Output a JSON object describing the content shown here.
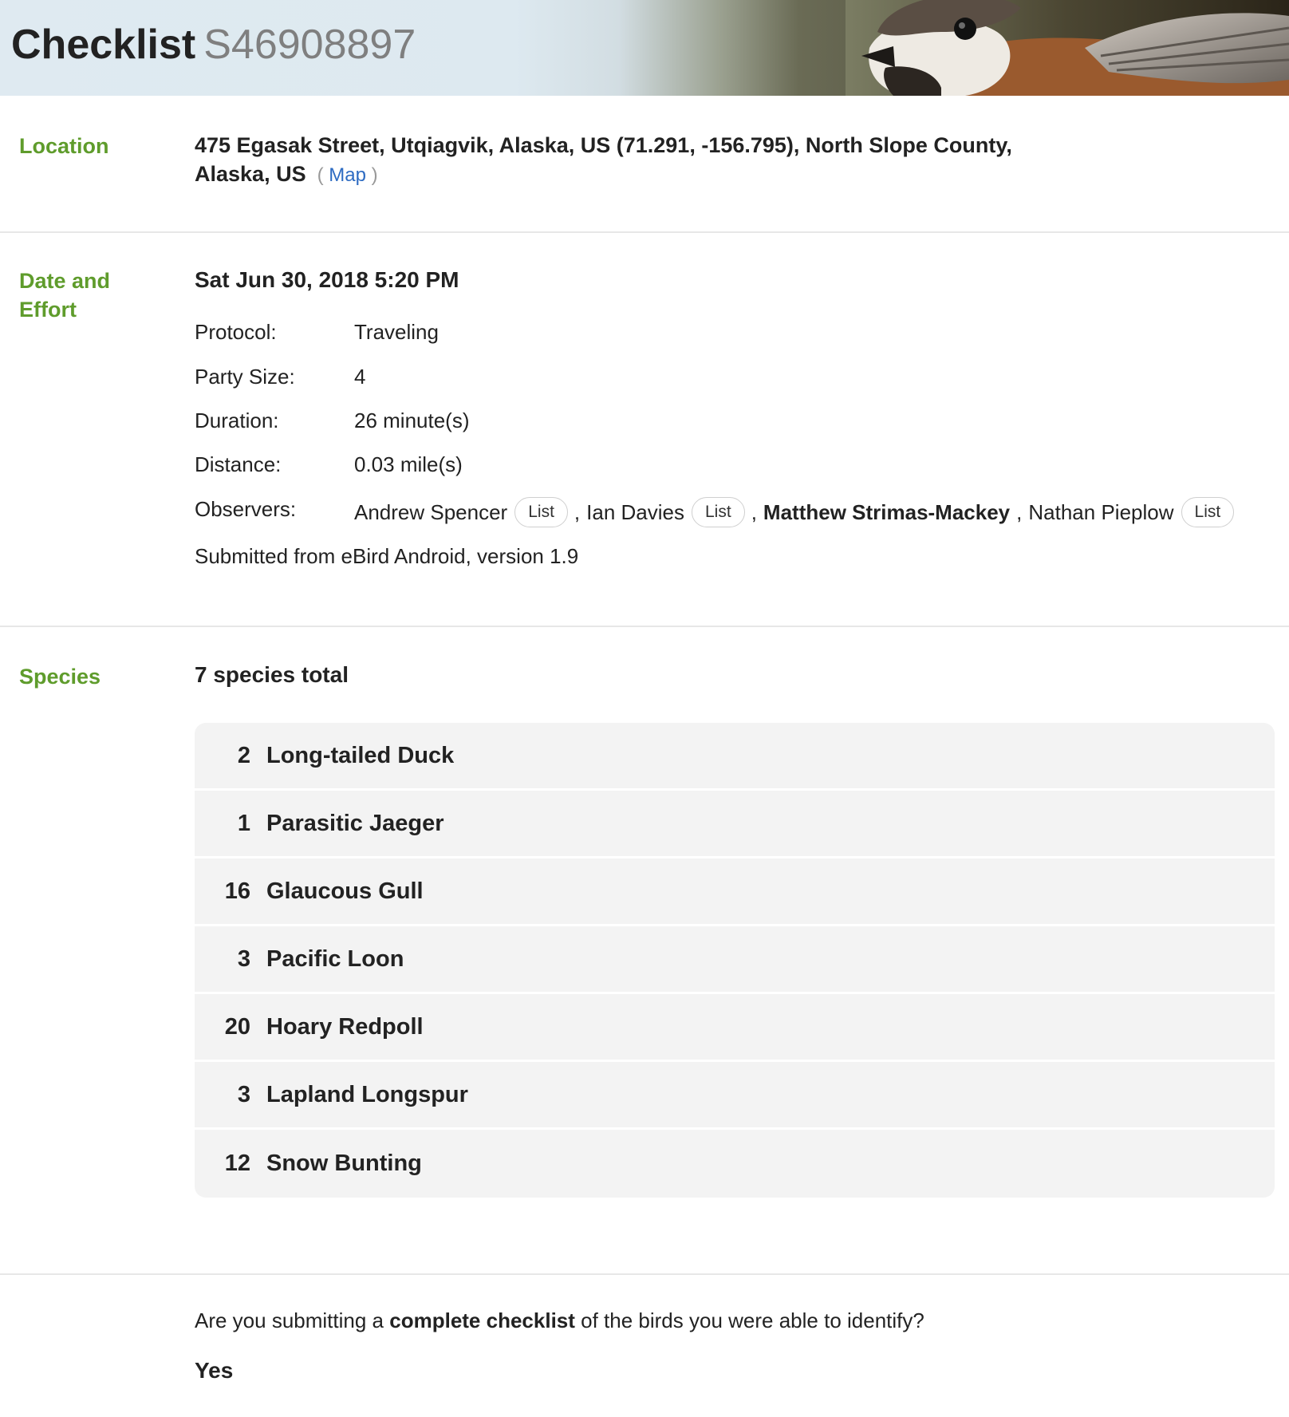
{
  "header": {
    "title": "Checklist",
    "checklist_id": "S46908897"
  },
  "location": {
    "label": "Location",
    "line1": "475 Egasak Street, Utqiagvik, Alaska, US (71.291, -156.795), North Slope County,",
    "line2": "Alaska, US",
    "map_link": "Map"
  },
  "date_effort": {
    "label_line1": "Date and",
    "label_line2": "Effort",
    "datetime": "Sat Jun 30, 2018 5:20 PM",
    "rows": [
      {
        "key": "Protocol:",
        "value": "Traveling"
      },
      {
        "key": "Party Size:",
        "value": "4"
      },
      {
        "key": "Duration:",
        "value": "26 minute(s)"
      },
      {
        "key": "Distance:",
        "value": "0.03 mile(s)"
      }
    ],
    "observers_key": "Observers:",
    "observers": [
      {
        "name": "Andrew Spencer",
        "button": "List"
      },
      {
        "name": "Ian Davies",
        "button": "List"
      },
      {
        "name": "Matthew Strimas-Mackey"
      },
      {
        "name": "Nathan Pieplow",
        "button": "List"
      }
    ],
    "separator": ",",
    "submitted": "Submitted from eBird Android, version 1.9"
  },
  "species": {
    "label": "Species",
    "total": "7 species total",
    "items": [
      {
        "count": "2",
        "name": "Long-tailed Duck"
      },
      {
        "count": "1",
        "name": "Parasitic Jaeger"
      },
      {
        "count": "16",
        "name": "Glaucous Gull"
      },
      {
        "count": "3",
        "name": "Pacific Loon"
      },
      {
        "count": "20",
        "name": "Hoary Redpoll"
      },
      {
        "count": "3",
        "name": "Lapland Longspur"
      },
      {
        "count": "12",
        "name": "Snow Bunting"
      }
    ]
  },
  "complete": {
    "question_pre": "Are you submitting a",
    "question_bold": "complete checklist",
    "question_post": "of the birds you were able to identify?",
    "answer": "Yes"
  },
  "colors": {
    "section_label": "#5f9c2c",
    "link": "#2d6bc2",
    "species_row_bg": "#f3f3f3"
  }
}
